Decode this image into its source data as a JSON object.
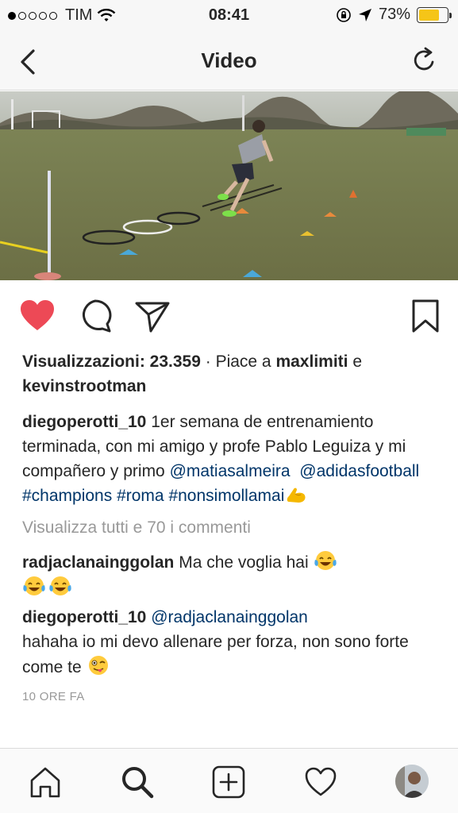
{
  "status_bar": {
    "carrier": "TIM",
    "signal_bars_filled": 1,
    "signal_bars_total": 5,
    "time": "08:41",
    "battery": "73%",
    "battery_level": 0.73,
    "battery_color": "#f5c518"
  },
  "nav": {
    "title": "Video",
    "back_icon": "chevron-left-icon",
    "refresh_icon": "refresh-icon"
  },
  "actions": {
    "like_color": "#ed4956",
    "icons": [
      "heart-filled-icon",
      "comment-icon",
      "share-icon",
      "bookmark-icon"
    ]
  },
  "stats": {
    "views_label": "Visualizzazioni: 23.359",
    "separator": " · ",
    "likes_prefix": "Piace a ",
    "liker1": "maxlimiti",
    "conj": "e",
    "liker2": "kevinstrootman"
  },
  "caption": {
    "user": "diegoperotti_10",
    "text": " 1er semana de entrenamiento terminada, con mi amigo y profe Pablo Leguiza y mi compañero y primo ",
    "mention1": "@matiasalmeira",
    "mention2": "@adidasfootball",
    "tag1": "#champions",
    "tag2": "#roma",
    "tag3": "#nonsimollamai",
    "emoji": "flexed-biceps-emoji"
  },
  "view_all_comments": "Visualizza tutti e 70 i commenti",
  "comments": [
    {
      "user": "radjaclanainggolan",
      "text": " Ma che voglia hai ",
      "emoji": "tears-of-joy-emoji"
    },
    {
      "user": "diegoperotti_10",
      "mention": "@radjaclanainggolan",
      "text": "hahaha io mi devo allenare per forza, non sono forte come te ",
      "emoji": "winking-tongue-emoji"
    }
  ],
  "time_ago": "10 ORE FA",
  "tab_bar": {
    "items": [
      "home-icon",
      "search-icon",
      "add-post-icon",
      "activity-heart-icon",
      "profile-avatar"
    ],
    "active": "search-icon"
  }
}
